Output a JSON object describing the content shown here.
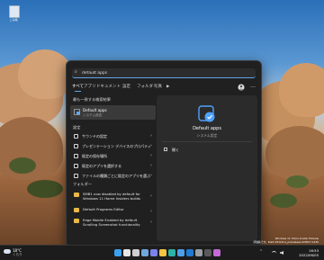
{
  "desktop": {
    "recycle_bin_label": "ごみ箱",
    "watermark_line1": "Windows 11 Home Insider Preview",
    "watermark_line2": "評価版です。Build 25120.rs_prerelease.220527-1430"
  },
  "search": {
    "query": "default apps"
  },
  "tabs": [
    {
      "label": "すべて",
      "active": true
    },
    {
      "label": "アプリ"
    },
    {
      "label": "ドキュメント"
    },
    {
      "label": "設定"
    },
    {
      "label": "フォルダー"
    },
    {
      "label": "写真"
    },
    {
      "label": "▶"
    }
  ],
  "top_icons": {
    "more": "…"
  },
  "best_match": {
    "section_title": "最も一致する検索結果",
    "name": "Default apps",
    "type": "システム設定"
  },
  "settings_section": {
    "title": "設定",
    "items": [
      {
        "label": "サウンドの設定"
      },
      {
        "label": "プレゼンテーション デバイスのプロパティ"
      },
      {
        "label": "既定の保存場所"
      },
      {
        "label": "既定のアプリを選択する"
      },
      {
        "label": "ファイルの種類ごとに既定のアプリを選ぶ"
      }
    ]
  },
  "folders_section": {
    "title": "フォルダー",
    "items": [
      {
        "label": "SMB1 now disabled by default for Windows 11 Home Insiders builds"
      },
      {
        "label": "Default Programs Editor"
      },
      {
        "label": "Edge Mobile Enabled by default Scrolling Screenshot functionality"
      }
    ]
  },
  "preview": {
    "name": "Default apps",
    "type": "システム設定",
    "open_label": "開く"
  },
  "taskbar": {
    "weather_temp": "18°C",
    "weather_desc": "くもり",
    "time": "16:53",
    "date": "2022/06/05",
    "icons": [
      {
        "name": "start-icon",
        "color": "#3aa0f0"
      },
      {
        "name": "search-icon",
        "color": "#e6e6e6"
      },
      {
        "name": "task-view-icon",
        "color": "#cfcfcf"
      },
      {
        "name": "widgets-icon",
        "color": "#6fa8dc"
      },
      {
        "name": "chat-icon",
        "color": "#7b83eb"
      },
      {
        "name": "file-explorer-icon",
        "color": "#f4c542"
      },
      {
        "name": "edge-icon",
        "color": "#2bb3a6"
      },
      {
        "name": "store-icon",
        "color": "#4da0e8"
      },
      {
        "name": "mail-icon",
        "color": "#1f7ad4"
      },
      {
        "name": "settings-icon",
        "color": "#9aa0a6"
      },
      {
        "name": "terminal-icon",
        "color": "#5a5a5a"
      },
      {
        "name": "photos-icon",
        "color": "#c36ad6"
      }
    ]
  }
}
